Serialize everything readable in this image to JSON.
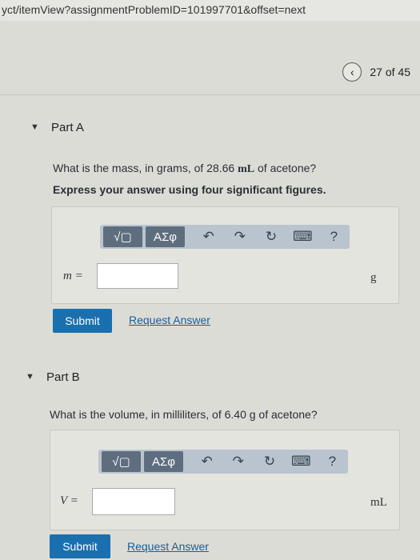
{
  "url": "yct/itemView?assignmentProblemID=101997701&offset=next",
  "pager": {
    "prev_icon": "chevron-left-icon",
    "counter": "27 of 45"
  },
  "part_a": {
    "title": "Part A",
    "question_pre": "What is the mass, in grams, of 28.66 ",
    "question_unit": "mL",
    "question_post": " of acetone?",
    "instruction": "Express your answer using four significant figures.",
    "toolbar": {
      "template": "√▢",
      "greek": "ΑΣφ",
      "undo": "↶",
      "redo": "↷",
      "reset": "↻",
      "keyboard": "⌨",
      "help": "?"
    },
    "variable": "m =",
    "input_value": "",
    "unit": "g",
    "submit_label": "Submit",
    "request_label": "Request Answer"
  },
  "part_b": {
    "title": "Part B",
    "question": "What is the volume, in milliliters, of 6.40 g of acetone?",
    "toolbar": {
      "template": "√▢",
      "greek": "ΑΣφ",
      "undo": "↶",
      "redo": "↷",
      "reset": "↻",
      "keyboard": "⌨",
      "help": "?"
    },
    "variable": "V =",
    "input_value": "",
    "unit": "mL",
    "submit_label": "Submit",
    "request_label": "Request Answer"
  }
}
